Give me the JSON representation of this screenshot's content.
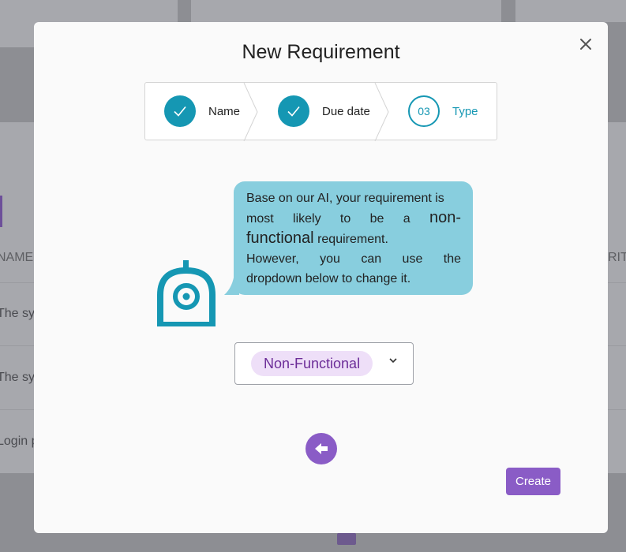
{
  "background": {
    "column_left": "NAME",
    "column_right": "RIT",
    "row_1": "The sy",
    "row_2": "The sy",
    "row_3": "Login p"
  },
  "modal": {
    "title": "New Requirement",
    "close_icon": "close-icon"
  },
  "stepper": {
    "steps": [
      {
        "label": "Name",
        "state": "done",
        "icon": "check-icon"
      },
      {
        "label": "Due date",
        "state": "done",
        "icon": "check-icon"
      },
      {
        "label": "Type",
        "state": "current",
        "number": "03"
      }
    ]
  },
  "bubble": {
    "line_1": "Base on our AI, your requirement is",
    "line_2_part_1": "most likely to be a ",
    "highlight_1": "non-",
    "highlight_2": "functional",
    "line_3_rest": " requirement.",
    "line_4": "However, you can use the",
    "line_5": "dropdown below to change it."
  },
  "robot": {
    "icon": "robot-icon"
  },
  "type_select": {
    "selected": "Non-Functional",
    "icon": "chevron-down-icon"
  },
  "actions": {
    "back_icon": "arrow-left-icon",
    "create_label": "Create"
  },
  "colors": {
    "accent_teal": "#1597b3",
    "bubble": "#88cede",
    "purple": "#8a5cc6",
    "chip_bg": "#eedff8",
    "chip_text": "#6c2d98"
  }
}
